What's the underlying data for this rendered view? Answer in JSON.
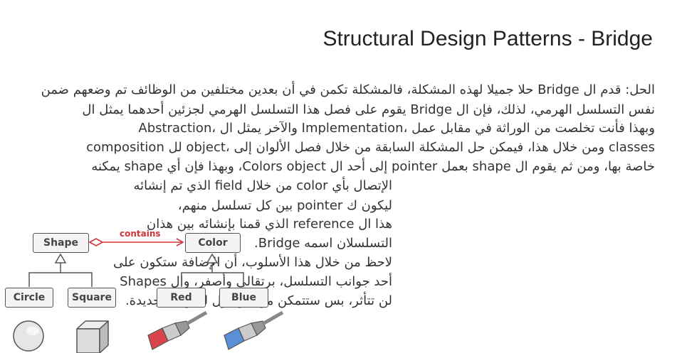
{
  "title": "Structural Design Patterns - Bridge",
  "paragraph": [
    "الحل: قدم ال Bridge حلا جميلا لهذه المشكلة، فالمشكلة تكمن في أن بعدين مختلفين من الوظائف تم وضعهم ضمن",
    "نفس التسلسل الهرمي، لذلك، فإن ال Bridge يقوم على فصل هذا التسلسل الهرمي لجزئين أحدهما يمثل ال",
    "Abstraction، والآخر يمثل ال Implementation، وبهذا فأنت تخلصت من الوراثة في مقابل عمل",
    "composition لل object، ومن خلال هذا، فيمكن حل المشكلة السابقة من خلال فصل الألوان إلى classes",
    "خاصة بها، ومن ثم يقوم ال shape بعمل pointer إلى أحد ال Colors object، وبهذا فإن أي shape يمكنه",
    "الإتصال بأي color من خلال field الذي تم إنشائه",
    "ليكون ك pointer بين كل تسلسل منهم،",
    "هذا ال reference الذي قمنا بإنشائه بين هذان",
    "التسلسلان اسمه Bridge.",
    "لاحظ من خلال هذا الأسلوب، أن الإضافة ستكون على",
    "أحد جوانب التسلسل، برتقالي وأصفر، وال Shapes",
    "لن تتأثر، بس ستتمكن من الوصول للألوان الجديدة."
  ],
  "diagram": {
    "shape": "Shape",
    "color": "Color",
    "relation": "contains",
    "circle": "Circle",
    "square": "Square",
    "red": "Red",
    "blue": "Blue",
    "relation_color": "#d0343c",
    "red_paint": "#d9454a",
    "blue_paint": "#5a8fd6"
  }
}
